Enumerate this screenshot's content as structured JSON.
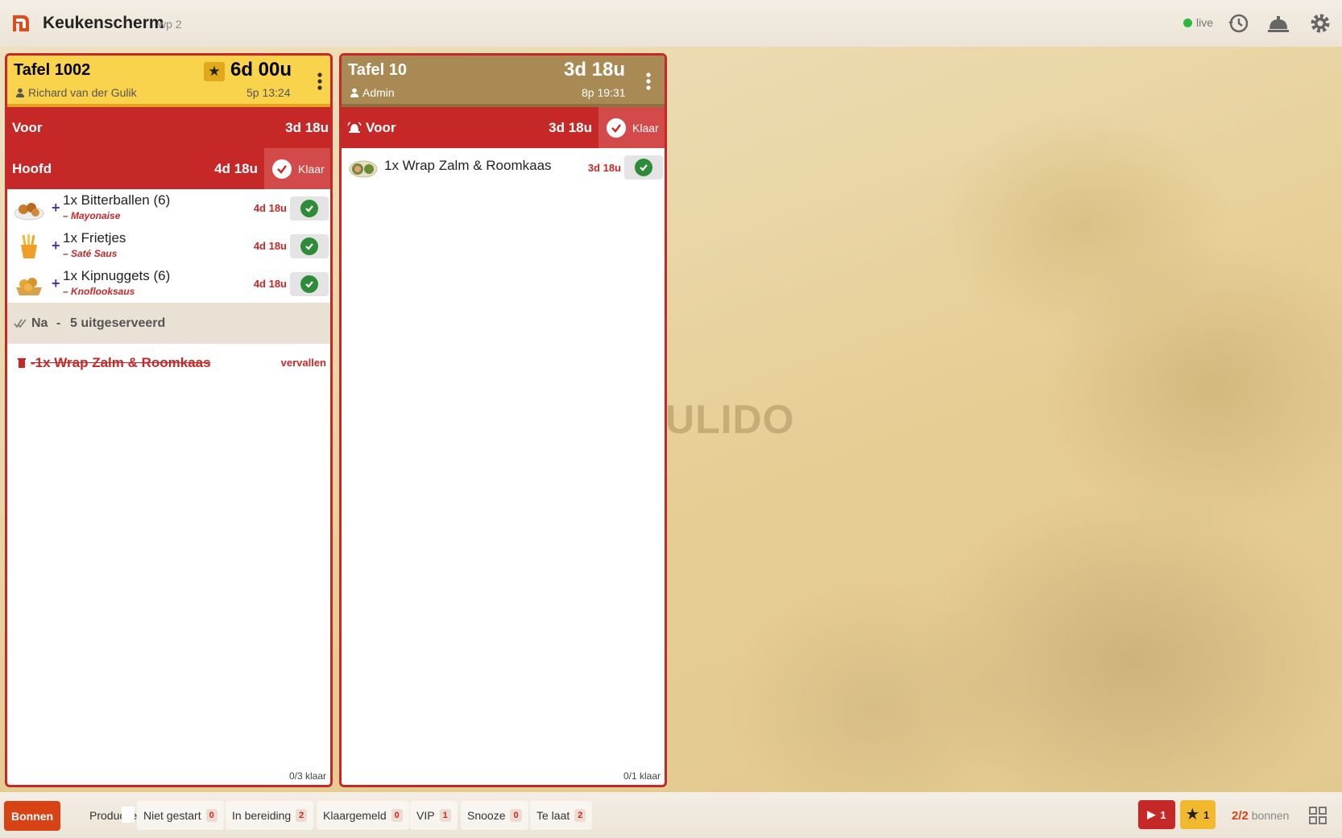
{
  "header": {
    "title": "Keukenscherm",
    "subtitle": "wp 2",
    "status_label": "live"
  },
  "watermark": "ULIDO",
  "tickets": [
    {
      "table": "Tafel 1002",
      "person": "Richard van der Gulik",
      "elapsed": "6d 00u",
      "meta": "5p 13:24",
      "vip": true,
      "courses": [
        {
          "name": "Voor",
          "time": "3d 18u",
          "has_ready_button": false,
          "ready_label": ""
        },
        {
          "name": "Hoofd",
          "time": "4d 18u",
          "has_ready_button": true,
          "ready_label": "Klaar"
        }
      ],
      "items": [
        {
          "name": "1x Bitterballen (6)",
          "modifier": "– Mayonaise",
          "time": "4d 18u",
          "icon": "bitterballen-image"
        },
        {
          "name": "1x Frietjes",
          "modifier": "– Saté Saus",
          "time": "4d 18u",
          "icon": "fries-image"
        },
        {
          "name": "1x Kipnuggets (6)",
          "modifier": "– Knoflooksaus",
          "time": "4d 18u",
          "icon": "nuggets-image"
        }
      ],
      "served_row": {
        "course": "Na",
        "separator": "-",
        "text": "5 uitgeserveerd"
      },
      "void_row": {
        "name": "-1x Wrap Zalm & Roomkaas",
        "status": "vervallen"
      },
      "ready_count": "0/3 klaar"
    },
    {
      "table": "Tafel 10",
      "person": "Admin",
      "elapsed": "3d 18u",
      "meta": "8p 19:31",
      "vip": false,
      "courses": [
        {
          "name": "Voor",
          "time": "3d 18u",
          "has_ready_button": true,
          "ready_label": "Klaar"
        }
      ],
      "items": [
        {
          "name": "1x Wrap Zalm & Roomkaas",
          "modifier": "",
          "time": "3d 18u",
          "icon": "wrap-image"
        }
      ],
      "ready_count": "0/1 klaar"
    }
  ],
  "bottom_bar": {
    "tabs": [
      {
        "label": "Bonnen",
        "active": true
      },
      {
        "label": "Productie",
        "active": false
      }
    ],
    "filters": [
      {
        "label": "Niet gestart",
        "count": "0"
      },
      {
        "label": "In bereiding",
        "count": "2"
      },
      {
        "label": "Klaargemeld",
        "count": "0"
      },
      {
        "label": "VIP",
        "count": "1"
      },
      {
        "label": "Snooze",
        "count": "0"
      },
      {
        "label": "Te laat",
        "count": "2"
      }
    ],
    "play_count": "1",
    "star_count": "1",
    "bonnen_fraction": "2/2",
    "bonnen_label": "bonnen"
  },
  "colors": {
    "accent_red": "#c62828",
    "vip_yellow": "#f9d34c",
    "header_brown": "#a98a55",
    "ready_green": "#2e8b3a",
    "active_tab": "#d84315"
  }
}
